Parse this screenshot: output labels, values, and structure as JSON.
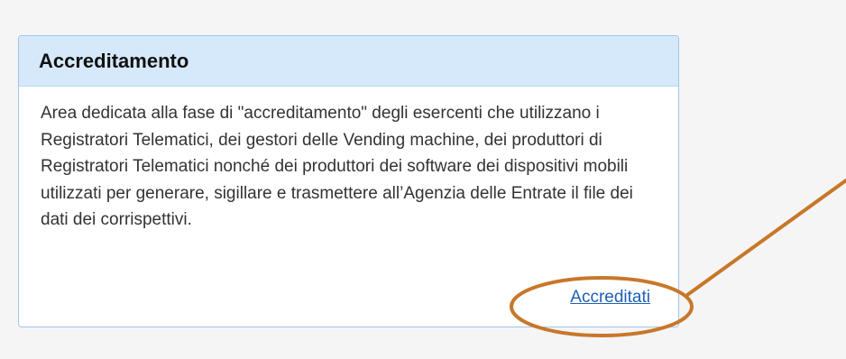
{
  "card": {
    "title": "Accreditamento",
    "description": "Area dedicata alla fase di \"accreditamento\" degli esercenti che utilizzano i Registratori Telematici, dei gestori delle Vending machine, dei produttori di Registratori Telematici nonché dei produttori dei software dei dispositivi mobili utilizzati per generare, sigillare e trasmettere all’Agenzia delle Entrate il file dei dati dei corrispettivi.",
    "link_label": "Accreditati"
  },
  "colors": {
    "page_background": "#f5f5f5",
    "header_background": "#d6e9fb",
    "panel_border": "#9ec5e8",
    "link": "#1f5fb4",
    "annotation": "#c8772a"
  }
}
